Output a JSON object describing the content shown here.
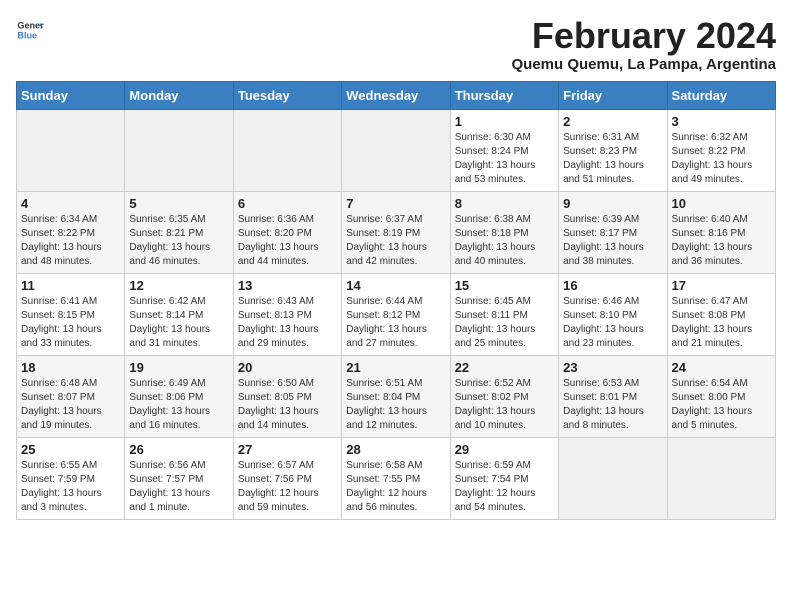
{
  "logo": {
    "general": "General",
    "blue": "Blue"
  },
  "calendar": {
    "title": "February 2024",
    "subtitle": "Quemu Quemu, La Pampa, Argentina",
    "days_of_week": [
      "Sunday",
      "Monday",
      "Tuesday",
      "Wednesday",
      "Thursday",
      "Friday",
      "Saturday"
    ],
    "weeks": [
      [
        {
          "day": "",
          "info": ""
        },
        {
          "day": "",
          "info": ""
        },
        {
          "day": "",
          "info": ""
        },
        {
          "day": "",
          "info": ""
        },
        {
          "day": "1",
          "info": "Sunrise: 6:30 AM\nSunset: 8:24 PM\nDaylight: 13 hours\nand 53 minutes."
        },
        {
          "day": "2",
          "info": "Sunrise: 6:31 AM\nSunset: 8:23 PM\nDaylight: 13 hours\nand 51 minutes."
        },
        {
          "day": "3",
          "info": "Sunrise: 6:32 AM\nSunset: 8:22 PM\nDaylight: 13 hours\nand 49 minutes."
        }
      ],
      [
        {
          "day": "4",
          "info": "Sunrise: 6:34 AM\nSunset: 8:22 PM\nDaylight: 13 hours\nand 48 minutes."
        },
        {
          "day": "5",
          "info": "Sunrise: 6:35 AM\nSunset: 8:21 PM\nDaylight: 13 hours\nand 46 minutes."
        },
        {
          "day": "6",
          "info": "Sunrise: 6:36 AM\nSunset: 8:20 PM\nDaylight: 13 hours\nand 44 minutes."
        },
        {
          "day": "7",
          "info": "Sunrise: 6:37 AM\nSunset: 8:19 PM\nDaylight: 13 hours\nand 42 minutes."
        },
        {
          "day": "8",
          "info": "Sunrise: 6:38 AM\nSunset: 8:18 PM\nDaylight: 13 hours\nand 40 minutes."
        },
        {
          "day": "9",
          "info": "Sunrise: 6:39 AM\nSunset: 8:17 PM\nDaylight: 13 hours\nand 38 minutes."
        },
        {
          "day": "10",
          "info": "Sunrise: 6:40 AM\nSunset: 8:16 PM\nDaylight: 13 hours\nand 36 minutes."
        }
      ],
      [
        {
          "day": "11",
          "info": "Sunrise: 6:41 AM\nSunset: 8:15 PM\nDaylight: 13 hours\nand 33 minutes."
        },
        {
          "day": "12",
          "info": "Sunrise: 6:42 AM\nSunset: 8:14 PM\nDaylight: 13 hours\nand 31 minutes."
        },
        {
          "day": "13",
          "info": "Sunrise: 6:43 AM\nSunset: 8:13 PM\nDaylight: 13 hours\nand 29 minutes."
        },
        {
          "day": "14",
          "info": "Sunrise: 6:44 AM\nSunset: 8:12 PM\nDaylight: 13 hours\nand 27 minutes."
        },
        {
          "day": "15",
          "info": "Sunrise: 6:45 AM\nSunset: 8:11 PM\nDaylight: 13 hours\nand 25 minutes."
        },
        {
          "day": "16",
          "info": "Sunrise: 6:46 AM\nSunset: 8:10 PM\nDaylight: 13 hours\nand 23 minutes."
        },
        {
          "day": "17",
          "info": "Sunrise: 6:47 AM\nSunset: 8:08 PM\nDaylight: 13 hours\nand 21 minutes."
        }
      ],
      [
        {
          "day": "18",
          "info": "Sunrise: 6:48 AM\nSunset: 8:07 PM\nDaylight: 13 hours\nand 19 minutes."
        },
        {
          "day": "19",
          "info": "Sunrise: 6:49 AM\nSunset: 8:06 PM\nDaylight: 13 hours\nand 16 minutes."
        },
        {
          "day": "20",
          "info": "Sunrise: 6:50 AM\nSunset: 8:05 PM\nDaylight: 13 hours\nand 14 minutes."
        },
        {
          "day": "21",
          "info": "Sunrise: 6:51 AM\nSunset: 8:04 PM\nDaylight: 13 hours\nand 12 minutes."
        },
        {
          "day": "22",
          "info": "Sunrise: 6:52 AM\nSunset: 8:02 PM\nDaylight: 13 hours\nand 10 minutes."
        },
        {
          "day": "23",
          "info": "Sunrise: 6:53 AM\nSunset: 8:01 PM\nDaylight: 13 hours\nand 8 minutes."
        },
        {
          "day": "24",
          "info": "Sunrise: 6:54 AM\nSunset: 8:00 PM\nDaylight: 13 hours\nand 5 minutes."
        }
      ],
      [
        {
          "day": "25",
          "info": "Sunrise: 6:55 AM\nSunset: 7:59 PM\nDaylight: 13 hours\nand 3 minutes."
        },
        {
          "day": "26",
          "info": "Sunrise: 6:56 AM\nSunset: 7:57 PM\nDaylight: 13 hours\nand 1 minute."
        },
        {
          "day": "27",
          "info": "Sunrise: 6:57 AM\nSunset: 7:56 PM\nDaylight: 12 hours\nand 59 minutes."
        },
        {
          "day": "28",
          "info": "Sunrise: 6:58 AM\nSunset: 7:55 PM\nDaylight: 12 hours\nand 56 minutes."
        },
        {
          "day": "29",
          "info": "Sunrise: 6:59 AM\nSunset: 7:54 PM\nDaylight: 12 hours\nand 54 minutes."
        },
        {
          "day": "",
          "info": ""
        },
        {
          "day": "",
          "info": ""
        }
      ]
    ]
  }
}
